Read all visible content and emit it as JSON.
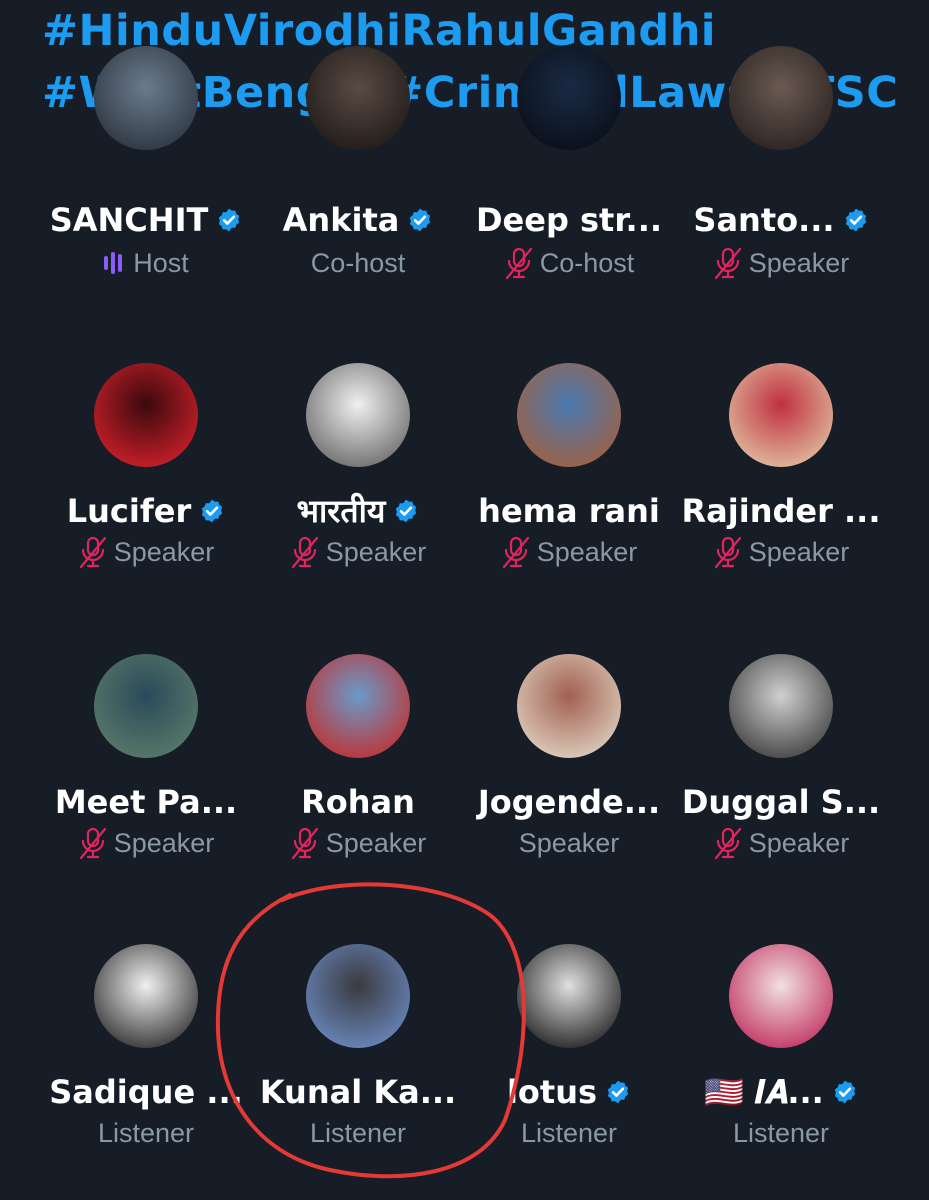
{
  "hashtags": {
    "line1": "#HinduVirodhiRahulGandhi",
    "line2": "#WestBengal #CriminalLaws #TSC"
  },
  "colors": {
    "background": "#161d27",
    "accent": "#1d9bf0",
    "muted_mic": "#e0245e",
    "host_bars": "#8b5cf6",
    "annotation": "#e53935"
  },
  "participants": [
    {
      "name": "SANCHIT",
      "role": "Host",
      "verified": true,
      "icon": "host-speaking-icon"
    },
    {
      "name": "Ankita",
      "role": "Co-host",
      "verified": true,
      "icon": ""
    },
    {
      "name": "Deep str...",
      "role": "Co-host",
      "verified": false,
      "icon": "muted-mic-icon"
    },
    {
      "name": "Santo...",
      "role": "Speaker",
      "verified": true,
      "icon": "muted-mic-icon"
    },
    {
      "name": "Lucifer",
      "role": "Speaker",
      "verified": true,
      "icon": "muted-mic-icon"
    },
    {
      "name": "भारतीय",
      "role": "Speaker",
      "verified": true,
      "icon": "muted-mic-icon"
    },
    {
      "name": "hema rani",
      "role": "Speaker",
      "verified": false,
      "icon": "muted-mic-icon"
    },
    {
      "name": "Rajinder ...",
      "role": "Speaker",
      "verified": false,
      "icon": "muted-mic-icon"
    },
    {
      "name": "Meet Pa...",
      "role": "Speaker",
      "verified": false,
      "icon": "muted-mic-icon"
    },
    {
      "name": "Rohan",
      "role": "Speaker",
      "verified": false,
      "icon": "muted-mic-icon"
    },
    {
      "name": "Jogende...",
      "role": "Speaker",
      "verified": false,
      "icon": ""
    },
    {
      "name": "Duggal S...",
      "role": "Speaker",
      "verified": false,
      "icon": "muted-mic-icon"
    },
    {
      "name": "Sadique ...",
      "role": "Listener",
      "verified": false,
      "icon": ""
    },
    {
      "name": "Kunal Ka...",
      "role": "Listener",
      "verified": false,
      "icon": ""
    },
    {
      "name": "lotus",
      "role": "Listener",
      "verified": true,
      "icon": ""
    },
    {
      "name": "🇺🇸 𝑰𝑨...",
      "role": "Listener",
      "verified": true,
      "icon": ""
    }
  ]
}
